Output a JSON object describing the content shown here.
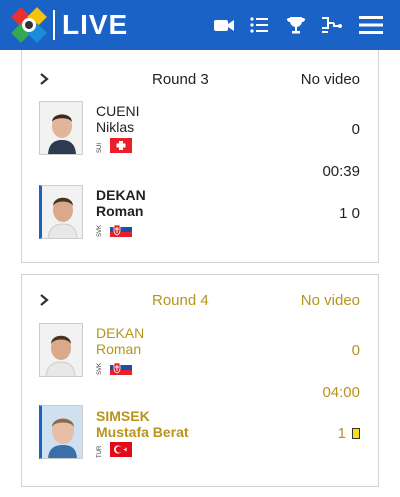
{
  "header": {
    "title": "LIVE",
    "icons": [
      "judo-logo-icon",
      "video-camera-icon",
      "list-icon",
      "trophy-icon",
      "bracket-icon",
      "hamburger-menu-icon"
    ],
    "brand_color": "#1a62c5"
  },
  "matches": [
    {
      "round": "Round 3",
      "video": "No video",
      "time": "00:39",
      "status_color": "#222222",
      "fighters": [
        {
          "last": "CUENI",
          "first": "Niklas",
          "country": "SUI",
          "score": "0",
          "winner": false
        },
        {
          "last": "DEKAN",
          "first": "Roman",
          "country": "SVK",
          "score": "1 0",
          "winner": true
        }
      ]
    },
    {
      "round": "Round 4",
      "video": "No video",
      "time": "04:00",
      "status_color": "#b8941a",
      "fighters": [
        {
          "last": "DEKAN",
          "first": "Roman",
          "country": "SVK",
          "score": "0",
          "winner": false
        },
        {
          "last": "SIMSEK",
          "first": "Mustafa Berat",
          "country": "TUR",
          "score": "1",
          "winner": true,
          "penalty": "yellow-card"
        }
      ]
    }
  ]
}
